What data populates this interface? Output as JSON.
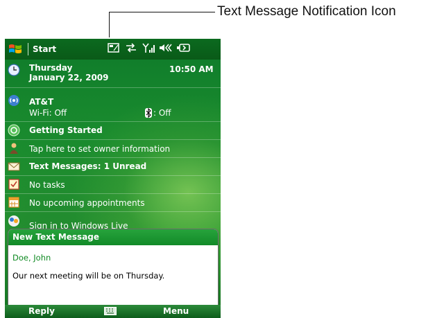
{
  "callout": {
    "label": "Text Message Notification Icon"
  },
  "titlebar": {
    "start_label": "Start",
    "icons": [
      "text-message-notification-icon",
      "connectivity-icon",
      "signal-icon",
      "volume-icon",
      "battery-icon"
    ]
  },
  "today": {
    "day": "Thursday",
    "date": "January 22, 2009",
    "time": "10:50 AM",
    "carrier": "AT&T",
    "wifi": "Wi-Fi: Off",
    "bluetooth": ": Off",
    "getting_started": "Getting Started",
    "owner": "Tap here to set owner information",
    "messages": "Text Messages: 1 Unread",
    "tasks": "No tasks",
    "appointments": "No upcoming appointments",
    "windows_live": "Sign in to Windows Live"
  },
  "popup": {
    "title": "New Text Message",
    "sender": "Doe, John",
    "body": "Our next meeting will be on Thursday."
  },
  "softkeys": {
    "left": "Reply",
    "right": "Menu"
  },
  "colors": {
    "green_dark": "#0a5a18",
    "green_accent": "#128a28",
    "sender": "#0f8a22"
  }
}
